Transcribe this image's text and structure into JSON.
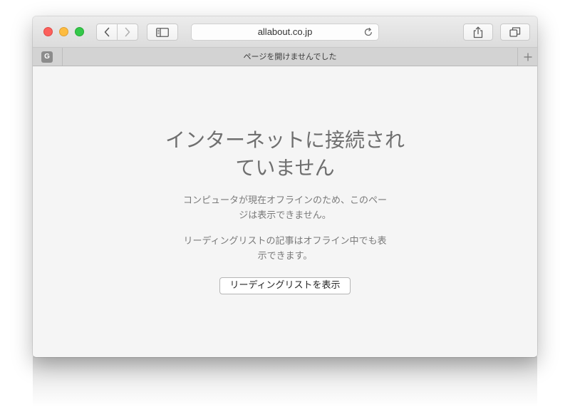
{
  "browser": {
    "address_bar": {
      "url_text": "allabout.co.jp"
    },
    "tab": {
      "favicon_letter": "G",
      "title": "ページを開けませんでした"
    },
    "colors": {
      "close": "#fc605c",
      "minimize": "#fdbc40",
      "zoom": "#34c84a"
    }
  },
  "error_page": {
    "heading_line1": "インターネットに接続され",
    "heading_line2": "ていません",
    "description1_line1": "コンピュータが現在オフラインのため、このペー",
    "description1_line2": "ジは表示できません。",
    "description2_line1": "リーディングリストの記事はオフライン中でも表",
    "description2_line2": "示できます。",
    "button_label": "リーディングリストを表示"
  },
  "icons": {
    "back": "chevron-left-icon",
    "forward": "chevron-right-icon",
    "sidebar": "sidebar-icon",
    "reload": "reload-icon",
    "share": "share-icon",
    "tabs": "tabs-overview-icon",
    "new_tab": "plus-icon"
  }
}
